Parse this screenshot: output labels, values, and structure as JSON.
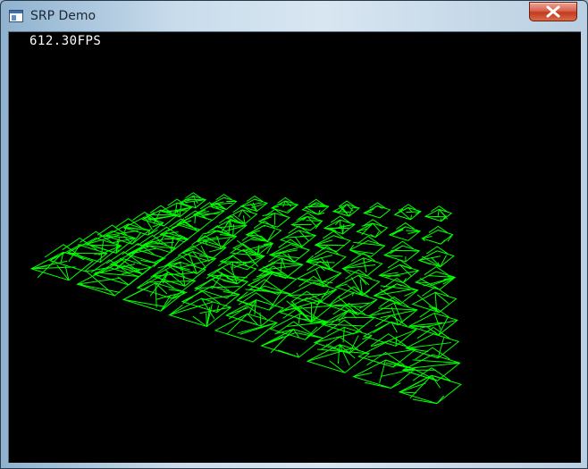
{
  "window": {
    "title": "SRP Demo",
    "icon": "application-window-icon",
    "close_icon": "close-icon"
  },
  "viewport": {
    "fps_text": "612.30FPS",
    "background": "#000000",
    "wireframe_color": "#00ff00",
    "grid_rows": 9,
    "grid_cols": 9
  }
}
